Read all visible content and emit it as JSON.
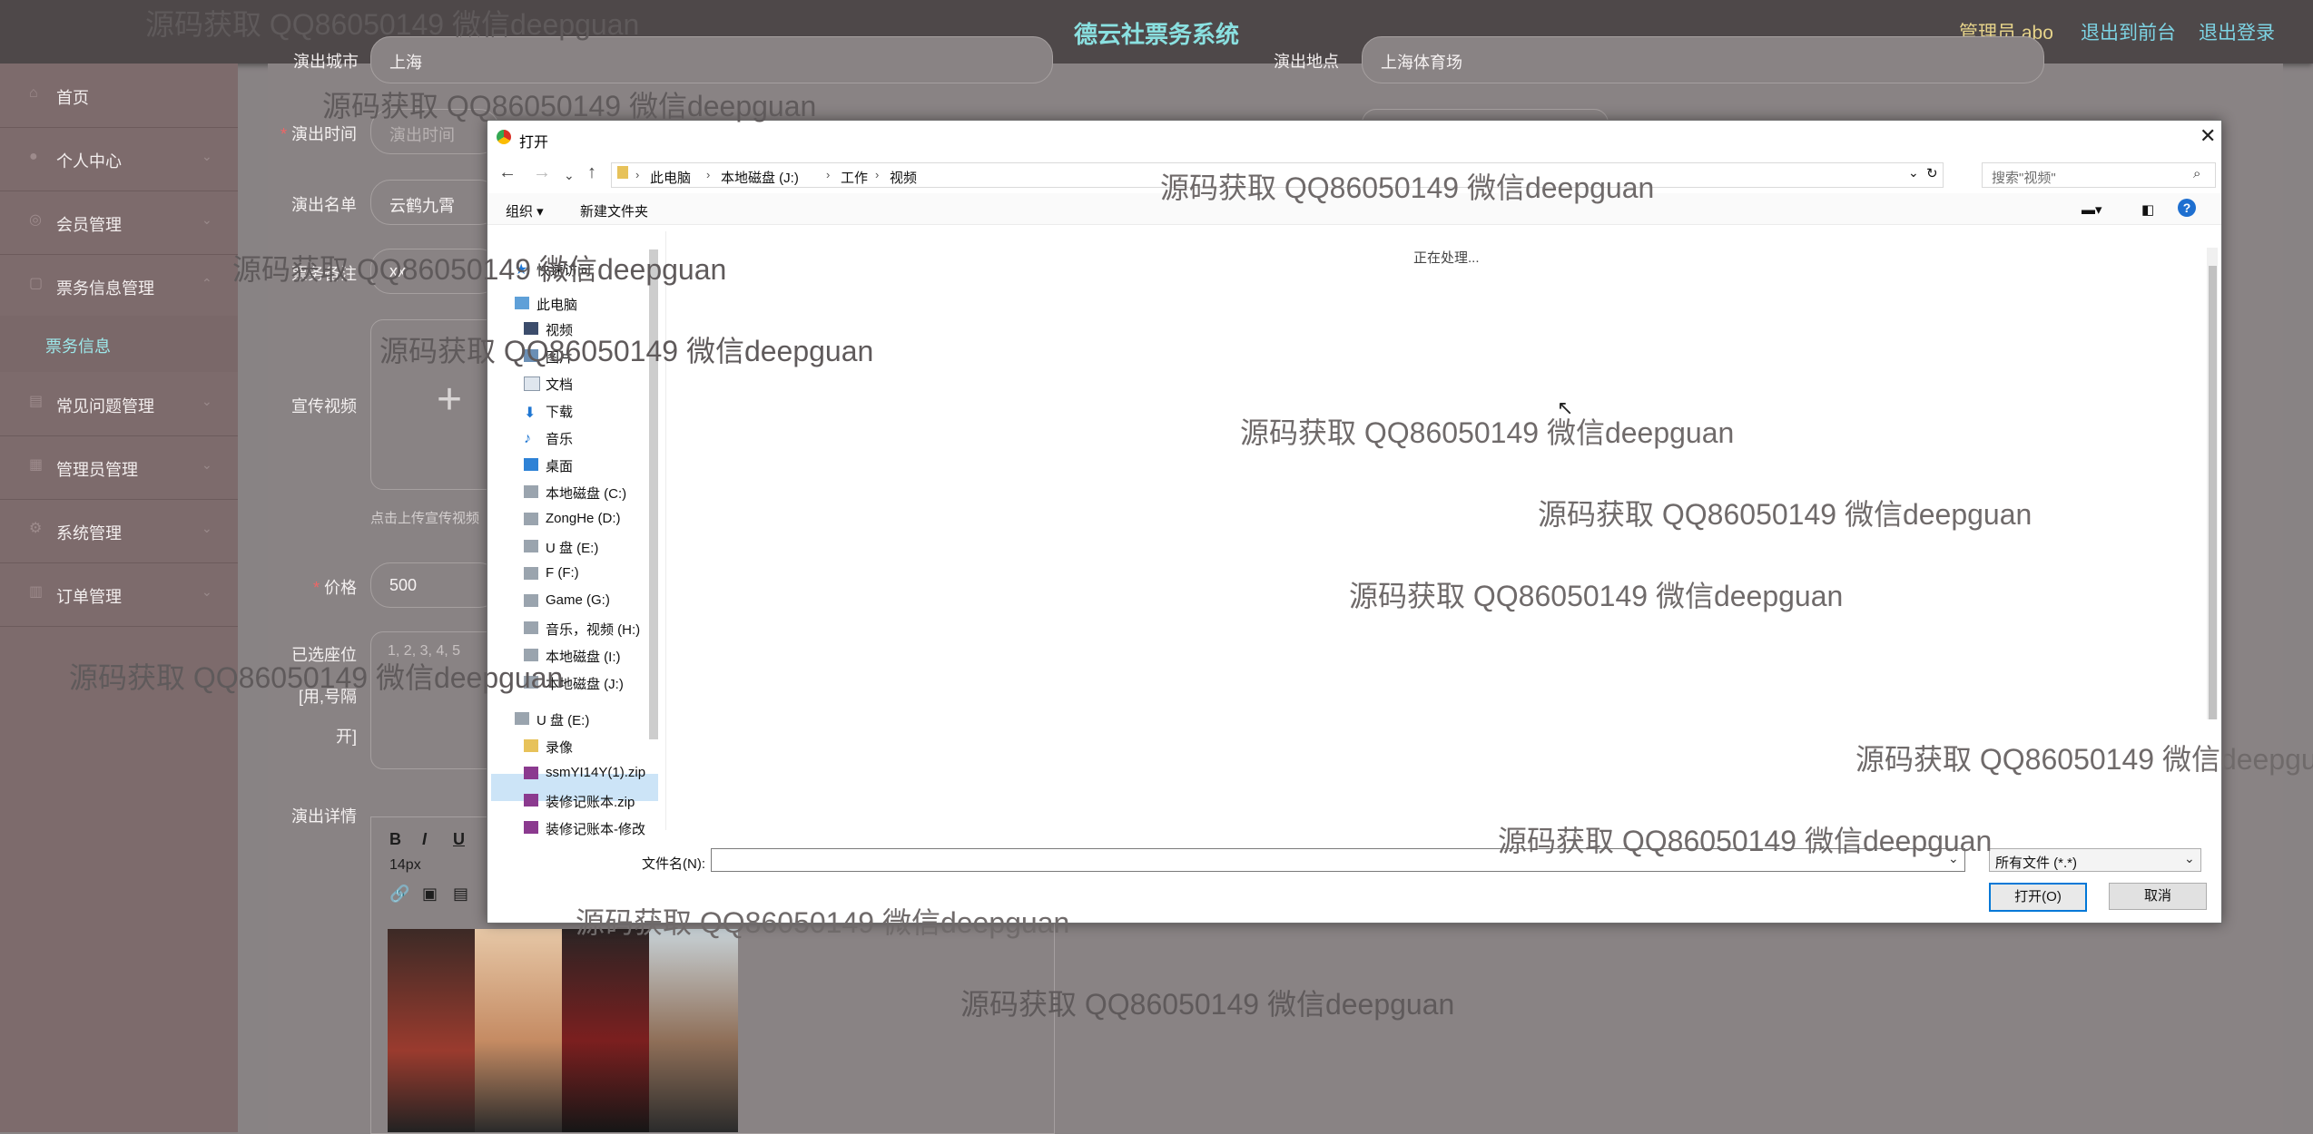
{
  "header": {
    "title": "德云社票务系统",
    "admin_label": "管理员 abo",
    "to_front": "退出到前台",
    "logout": "退出登录"
  },
  "sidebar": {
    "items": [
      {
        "label": "首页",
        "icon": "home-icon"
      },
      {
        "label": "个人中心",
        "icon": "user-icon"
      },
      {
        "label": "会员管理",
        "icon": "member-icon"
      },
      {
        "label": "票务信息管理",
        "icon": "ticket-icon"
      },
      {
        "label": "常见问题管理",
        "icon": "faq-icon"
      },
      {
        "label": "管理员管理",
        "icon": "admin-icon"
      },
      {
        "label": "系统管理",
        "icon": "system-icon"
      },
      {
        "label": "订单管理",
        "icon": "order-icon"
      }
    ],
    "active_sub": "票务信息"
  },
  "form": {
    "city_label": "演出城市",
    "city_value": "上海",
    "venue_label": "演出地点",
    "venue_value": "上海体育场",
    "time_label": "演出时间",
    "time_placeholder": "演出时间",
    "cast_label": "演出名单",
    "cast_value": "云鹤九霄",
    "remark_label": "票务备注",
    "remark_value": "xx",
    "video_label": "宣传视频",
    "video_hint": "点击上传宣传视频",
    "price_label": "价格",
    "price_value": "500",
    "seat_label_1": "已选座位",
    "seat_label_2": "[用,号隔",
    "seat_label_3": "开]",
    "seat_placeholder": "1, 2, 3, 4, 5",
    "detail_label": "演出详情",
    "font_size": "14px"
  },
  "dialog": {
    "title": "打开",
    "breadcrumb": [
      "此电脑",
      "本地磁盘 (J:)",
      "工作",
      "视频"
    ],
    "search_placeholder": "搜索\"视频\"",
    "organize": "组织 ▾",
    "new_folder": "新建文件夹",
    "status": "正在处理...",
    "nav_items": [
      "快速访问",
      "此电脑",
      "视频",
      "图片",
      "文档",
      "下载",
      "音乐",
      "桌面",
      "本地磁盘 (C:)",
      "ZongHe (D:)",
      "U 盘 (E:)",
      "F (F:)",
      "Game (G:)",
      "音乐，视频 (H:)",
      "本地磁盘 (I:)",
      "本地磁盘 (J:)",
      "U 盘 (E:)",
      "录像",
      "ssmYI14Y(1).zip",
      "装修记账本.zip",
      "装修记账本-修改"
    ],
    "filename_label": "文件名(N):",
    "filetype": "所有文件 (*.*)",
    "open_btn": "打开(O)",
    "cancel_btn": "取消"
  },
  "watermark": "源码获取 QQ86050149 微信deepguan"
}
